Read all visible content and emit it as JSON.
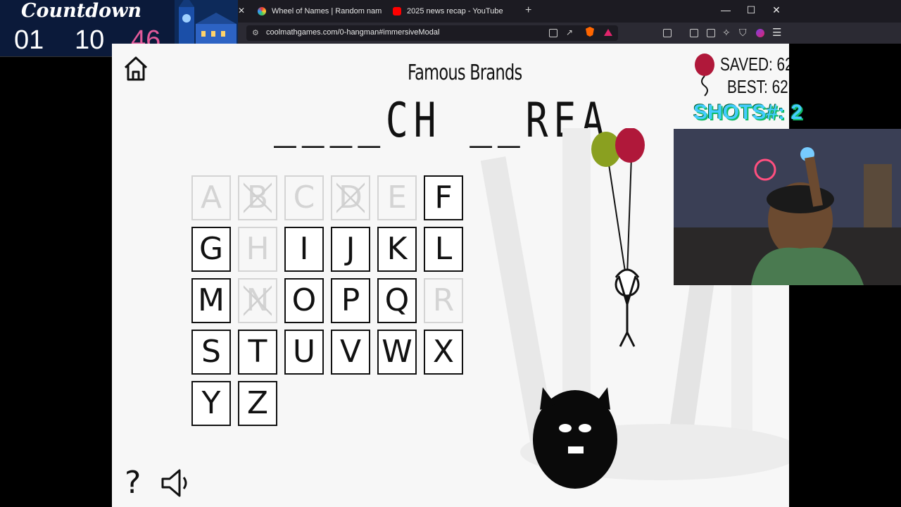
{
  "countdown": {
    "title": "Countdown",
    "hours": "01",
    "minutes": "10",
    "seconds": "46"
  },
  "browser": {
    "tabs": [
      {
        "label": "Wheel of Names | Random name pic"
      },
      {
        "label": "2025 news recap - YouTube"
      }
    ],
    "url": "coolmathgames.com/0-hangman#immersiveModal"
  },
  "game": {
    "category": "Famous Brands",
    "puzzle": "____CH __REA_",
    "saved_label": "SAVED: 62",
    "best_label": "BEST: 62",
    "keys": [
      {
        "letter": "A",
        "state": "used"
      },
      {
        "letter": "B",
        "state": "wrong"
      },
      {
        "letter": "C",
        "state": "used"
      },
      {
        "letter": "D",
        "state": "wrong"
      },
      {
        "letter": "E",
        "state": "used"
      },
      {
        "letter": "F",
        "state": "available"
      },
      {
        "letter": "G",
        "state": "available"
      },
      {
        "letter": "H",
        "state": "used"
      },
      {
        "letter": "I",
        "state": "available"
      },
      {
        "letter": "J",
        "state": "available"
      },
      {
        "letter": "K",
        "state": "available"
      },
      {
        "letter": "L",
        "state": "available"
      },
      {
        "letter": "M",
        "state": "available"
      },
      {
        "letter": "N",
        "state": "wrong"
      },
      {
        "letter": "O",
        "state": "available"
      },
      {
        "letter": "P",
        "state": "available"
      },
      {
        "letter": "Q",
        "state": "available"
      },
      {
        "letter": "R",
        "state": "used"
      },
      {
        "letter": "S",
        "state": "available"
      },
      {
        "letter": "T",
        "state": "available"
      },
      {
        "letter": "U",
        "state": "available"
      },
      {
        "letter": "V",
        "state": "available"
      },
      {
        "letter": "W",
        "state": "available"
      },
      {
        "letter": "X",
        "state": "available"
      },
      {
        "letter": "Y",
        "state": "available"
      },
      {
        "letter": "Z",
        "state": "available"
      }
    ],
    "help_label": "?"
  },
  "overlay": {
    "shots_label": "SHOTS#: 2"
  },
  "colors": {
    "countdown_seconds": "#e35a9a",
    "balloon_red": "#b0183a",
    "balloon_green": "#8aa020"
  }
}
